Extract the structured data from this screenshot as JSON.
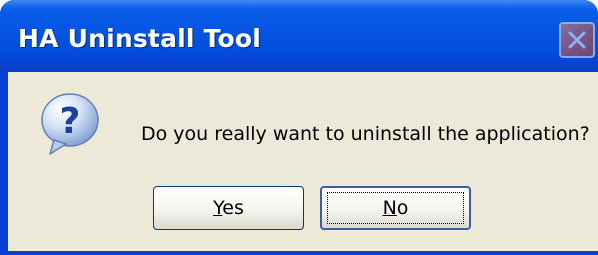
{
  "window": {
    "title": "HA Uninstall Tool",
    "close_icon": "close-icon",
    "accent_color": "#0554e3"
  },
  "dialog": {
    "icon": "question-icon",
    "message": "Do you really want to uninstall the application?"
  },
  "buttons": {
    "yes": {
      "mnemonic": "Y",
      "rest": "es"
    },
    "no": {
      "mnemonic": "N",
      "rest": "o",
      "focused": true
    }
  }
}
